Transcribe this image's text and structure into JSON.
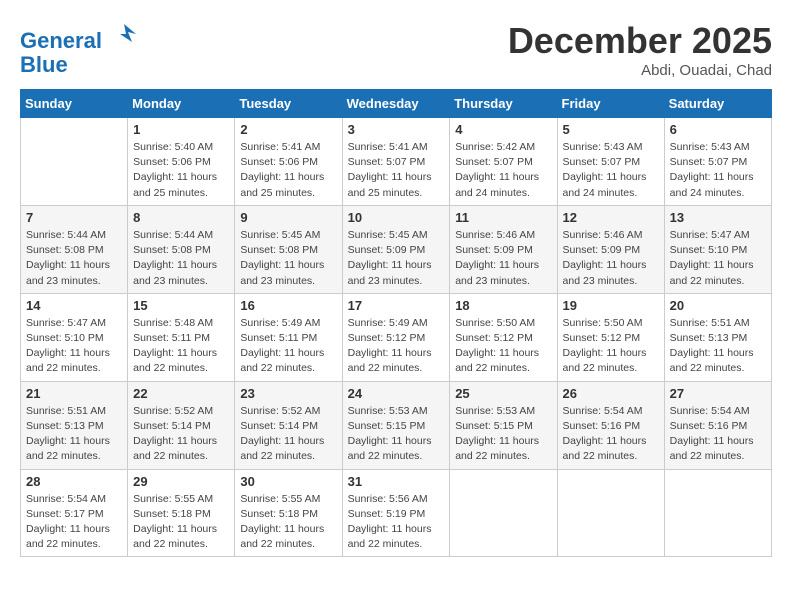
{
  "logo": {
    "line1": "General",
    "line2": "Blue"
  },
  "title": "December 2025",
  "subtitle": "Abdi, Ouadai, Chad",
  "days_of_week": [
    "Sunday",
    "Monday",
    "Tuesday",
    "Wednesday",
    "Thursday",
    "Friday",
    "Saturday"
  ],
  "weeks": [
    [
      {
        "day": "",
        "info": ""
      },
      {
        "day": "1",
        "info": "Sunrise: 5:40 AM\nSunset: 5:06 PM\nDaylight: 11 hours\nand 25 minutes."
      },
      {
        "day": "2",
        "info": "Sunrise: 5:41 AM\nSunset: 5:06 PM\nDaylight: 11 hours\nand 25 minutes."
      },
      {
        "day": "3",
        "info": "Sunrise: 5:41 AM\nSunset: 5:07 PM\nDaylight: 11 hours\nand 25 minutes."
      },
      {
        "day": "4",
        "info": "Sunrise: 5:42 AM\nSunset: 5:07 PM\nDaylight: 11 hours\nand 24 minutes."
      },
      {
        "day": "5",
        "info": "Sunrise: 5:43 AM\nSunset: 5:07 PM\nDaylight: 11 hours\nand 24 minutes."
      },
      {
        "day": "6",
        "info": "Sunrise: 5:43 AM\nSunset: 5:07 PM\nDaylight: 11 hours\nand 24 minutes."
      }
    ],
    [
      {
        "day": "7",
        "info": "Sunrise: 5:44 AM\nSunset: 5:08 PM\nDaylight: 11 hours\nand 23 minutes."
      },
      {
        "day": "8",
        "info": "Sunrise: 5:44 AM\nSunset: 5:08 PM\nDaylight: 11 hours\nand 23 minutes."
      },
      {
        "day": "9",
        "info": "Sunrise: 5:45 AM\nSunset: 5:08 PM\nDaylight: 11 hours\nand 23 minutes."
      },
      {
        "day": "10",
        "info": "Sunrise: 5:45 AM\nSunset: 5:09 PM\nDaylight: 11 hours\nand 23 minutes."
      },
      {
        "day": "11",
        "info": "Sunrise: 5:46 AM\nSunset: 5:09 PM\nDaylight: 11 hours\nand 23 minutes."
      },
      {
        "day": "12",
        "info": "Sunrise: 5:46 AM\nSunset: 5:09 PM\nDaylight: 11 hours\nand 23 minutes."
      },
      {
        "day": "13",
        "info": "Sunrise: 5:47 AM\nSunset: 5:10 PM\nDaylight: 11 hours\nand 22 minutes."
      }
    ],
    [
      {
        "day": "14",
        "info": "Sunrise: 5:47 AM\nSunset: 5:10 PM\nDaylight: 11 hours\nand 22 minutes."
      },
      {
        "day": "15",
        "info": "Sunrise: 5:48 AM\nSunset: 5:11 PM\nDaylight: 11 hours\nand 22 minutes."
      },
      {
        "day": "16",
        "info": "Sunrise: 5:49 AM\nSunset: 5:11 PM\nDaylight: 11 hours\nand 22 minutes."
      },
      {
        "day": "17",
        "info": "Sunrise: 5:49 AM\nSunset: 5:12 PM\nDaylight: 11 hours\nand 22 minutes."
      },
      {
        "day": "18",
        "info": "Sunrise: 5:50 AM\nSunset: 5:12 PM\nDaylight: 11 hours\nand 22 minutes."
      },
      {
        "day": "19",
        "info": "Sunrise: 5:50 AM\nSunset: 5:12 PM\nDaylight: 11 hours\nand 22 minutes."
      },
      {
        "day": "20",
        "info": "Sunrise: 5:51 AM\nSunset: 5:13 PM\nDaylight: 11 hours\nand 22 minutes."
      }
    ],
    [
      {
        "day": "21",
        "info": "Sunrise: 5:51 AM\nSunset: 5:13 PM\nDaylight: 11 hours\nand 22 minutes."
      },
      {
        "day": "22",
        "info": "Sunrise: 5:52 AM\nSunset: 5:14 PM\nDaylight: 11 hours\nand 22 minutes."
      },
      {
        "day": "23",
        "info": "Sunrise: 5:52 AM\nSunset: 5:14 PM\nDaylight: 11 hours\nand 22 minutes."
      },
      {
        "day": "24",
        "info": "Sunrise: 5:53 AM\nSunset: 5:15 PM\nDaylight: 11 hours\nand 22 minutes."
      },
      {
        "day": "25",
        "info": "Sunrise: 5:53 AM\nSunset: 5:15 PM\nDaylight: 11 hours\nand 22 minutes."
      },
      {
        "day": "26",
        "info": "Sunrise: 5:54 AM\nSunset: 5:16 PM\nDaylight: 11 hours\nand 22 minutes."
      },
      {
        "day": "27",
        "info": "Sunrise: 5:54 AM\nSunset: 5:16 PM\nDaylight: 11 hours\nand 22 minutes."
      }
    ],
    [
      {
        "day": "28",
        "info": "Sunrise: 5:54 AM\nSunset: 5:17 PM\nDaylight: 11 hours\nand 22 minutes."
      },
      {
        "day": "29",
        "info": "Sunrise: 5:55 AM\nSunset: 5:18 PM\nDaylight: 11 hours\nand 22 minutes."
      },
      {
        "day": "30",
        "info": "Sunrise: 5:55 AM\nSunset: 5:18 PM\nDaylight: 11 hours\nand 22 minutes."
      },
      {
        "day": "31",
        "info": "Sunrise: 5:56 AM\nSunset: 5:19 PM\nDaylight: 11 hours\nand 22 minutes."
      },
      {
        "day": "",
        "info": ""
      },
      {
        "day": "",
        "info": ""
      },
      {
        "day": "",
        "info": ""
      }
    ]
  ]
}
